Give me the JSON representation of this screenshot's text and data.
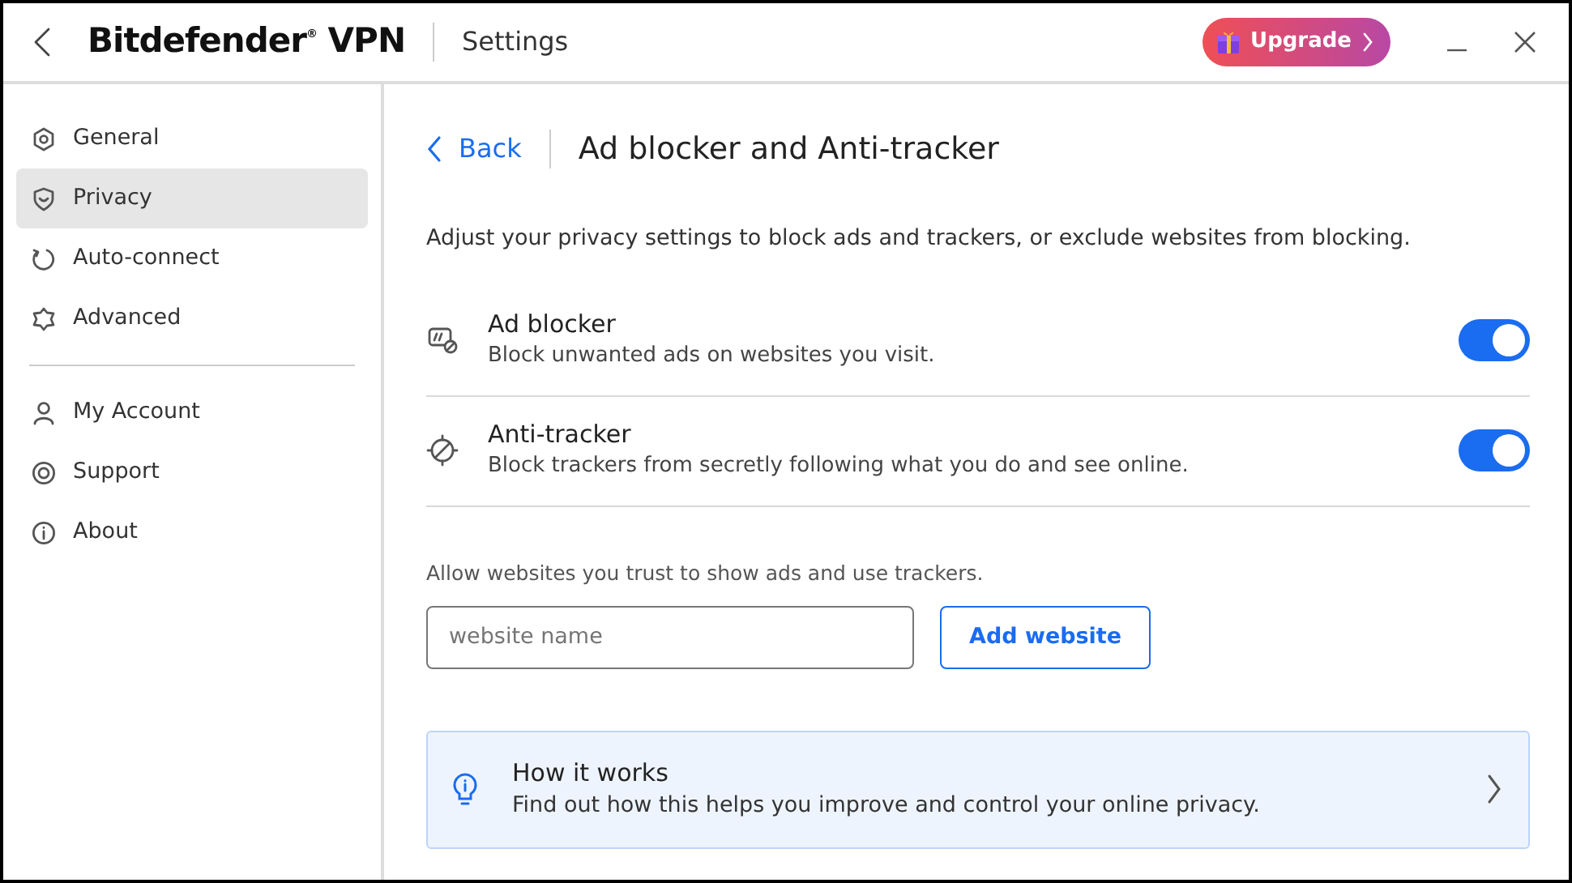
{
  "header": {
    "brand": "Bitdefender$^{®}$ VPN",
    "title": "Settings",
    "upgrade": "Upgrade"
  },
  "sidebar": {
    "groups": [
      [
        {
          "label": "General",
          "selected": false
        },
        {
          "label": "Privacy",
          "selected": true
        },
        {
          "label": "Auto-connect",
          "selected": false
        },
        {
          "label": "Advanced",
          "selected": false
        }
      ],
      [
        {
          "label": "My Account",
          "selected": false
        },
        {
          "label": "Support",
          "selected": false
        },
        {
          "label": "About",
          "selected": false
        }
      ]
    ]
  },
  "page": {
    "back": "Back",
    "title": "Ad blocker and Anti-tracker",
    "intro": "Adjust your privacy settings to block ads and trackers, or exclude websites from blocking.",
    "settings": [
      {
        "title": "Ad blocker",
        "description": "Block unwanted ads on websites you visit.",
        "on": true
      },
      {
        "title": "Anti-tracker",
        "description": "Block trackers from secretly following what you do and see online.",
        "on": true
      }
    ],
    "allow_label": "Allow websites you trust to show ads and use trackers.",
    "website_field": {
      "placeholder": "website name"
    },
    "add_button": "Add website",
    "info_card": {
      "title": "How it works",
      "text": "Find out how this helps you improve and control your online privacy."
    }
  }
}
